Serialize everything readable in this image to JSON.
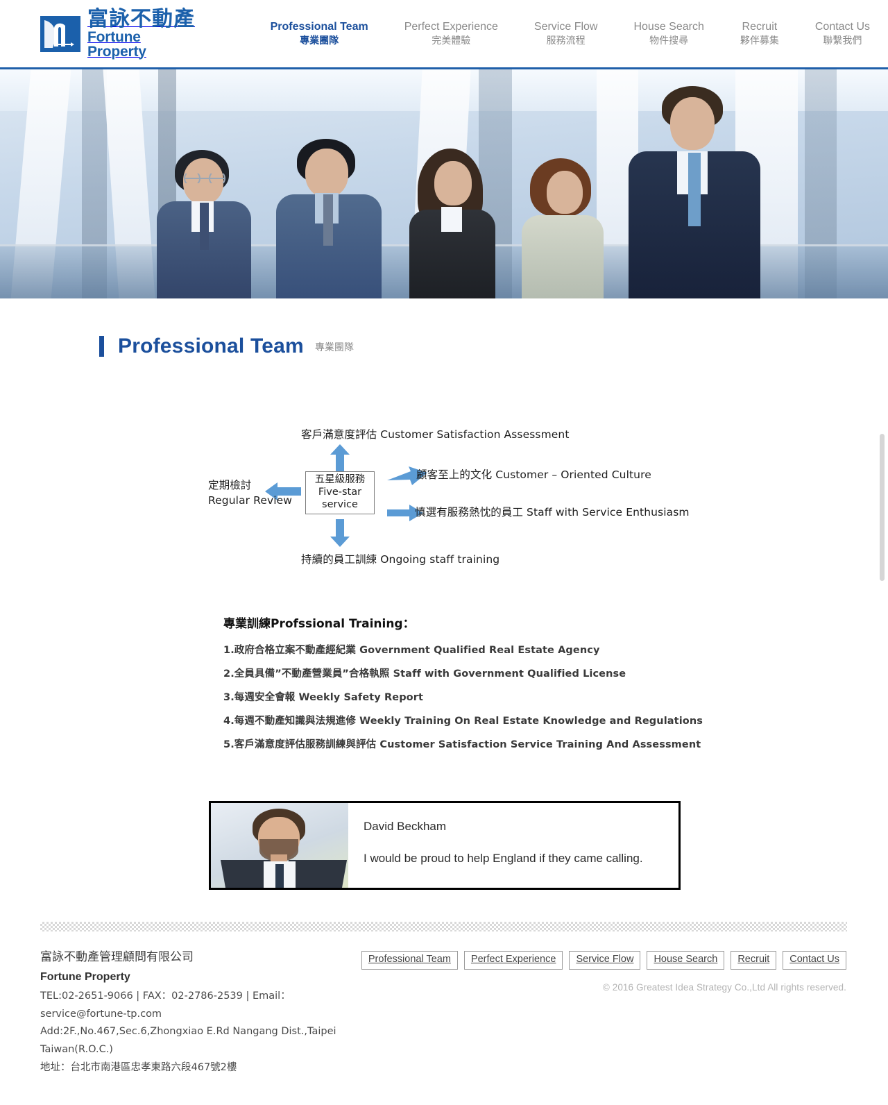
{
  "header": {
    "logo": {
      "icon": "fortune-property-logo-icon",
      "name_cn": "富詠不動產",
      "name_en": "Fortune Property"
    },
    "nav": [
      {
        "en": "Professional Team",
        "cn": "專業團隊",
        "active": true
      },
      {
        "en": "Perfect Experience",
        "cn": "完美體驗",
        "active": false
      },
      {
        "en": "Service Flow",
        "cn": "服務流程",
        "active": false
      },
      {
        "en": "House Search",
        "cn": "物件搜尋",
        "active": false
      },
      {
        "en": "Recruit",
        "cn": "夥伴募集",
        "active": false
      },
      {
        "en": "Contact Us",
        "cn": "聯繫我們",
        "active": false
      }
    ]
  },
  "hero": {
    "alt": "five business professionals standing in a modern office corridor"
  },
  "page_title": {
    "en": "Professional Team",
    "cn": "專業團隊"
  },
  "diagram": {
    "center": {
      "cn": "五星級服務",
      "en_line1": "Five-star",
      "en_line2": "service"
    },
    "top": "客戶滿意度評估 Customer Satisfaction Assessment",
    "right_upper": "顧客至上的文化 Customer – Oriented Culture",
    "right_lower": "慎選有服務熱忱的員工 Staff with Service Enthusiasm",
    "left_line1": "定期檢討",
    "left_line2": "Regular Review",
    "bottom": "持續的員工訓練 Ongoing staff training",
    "arrow_color": "#5b9bd5"
  },
  "training": {
    "title": "專業訓練Profssional Training：",
    "items": [
      "1.政府合格立案不動產經紀業 Government Qualified Real Estate Agency",
      "2.全員具備”不動產營業員”合格執照 Staff with Government Qualified License",
      "3.每週安全會報 Weekly Safety Report",
      "4.每週不動產知識與法規進修 Weekly Training On Real Estate Knowledge and Regulations",
      "5.客戶滿意度評估服務訓練與評估 Customer Satisfaction Service Training And Assessment"
    ]
  },
  "quote": {
    "photo_alt": "portrait of David Beckham in a dark suit",
    "name": "David Beckham",
    "text": "I would be proud to help England if they came calling."
  },
  "footer": {
    "company_cn": "富詠不動產管理顧問有限公司",
    "company_en": "Fortune Property",
    "contact": "TEL:02-2651-9066 | FAX：02-2786-2539 | Email：service@fortune-tp.com",
    "address_en": "Add:2F.,No.467,Sec.6,Zhongxiao E.Rd Nangang Dist.,Taipei Taiwan(R.O.C.)",
    "address_cn": "地址：台北市南港區忠孝東路六段467號2樓",
    "links": [
      "Professional Team",
      "Perfect Experience",
      "Service Flow",
      "House Search",
      "Recruit",
      "Contact Us"
    ],
    "copyright": "© 2016 Greatest Idea Strategy Co.,Ltd All rights reserved."
  },
  "colors": {
    "brand_blue": "#1b4f9c",
    "header_rule": "#1f5fa9",
    "arrow_blue": "#5b9bd5",
    "muted_text": "#8a8a8a"
  }
}
